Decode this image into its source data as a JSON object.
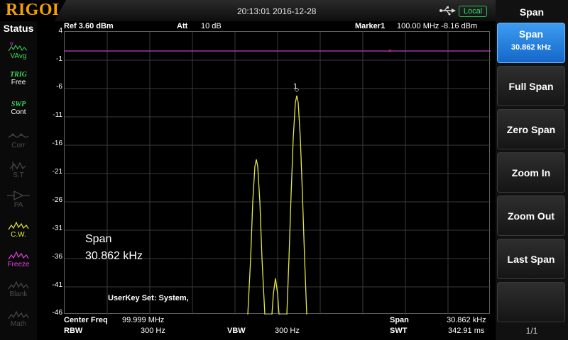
{
  "header": {
    "brand": "RIGOL",
    "datetime": "20:13:01 2016-12-28",
    "usb_icon": "usb-icon",
    "local_label": "Local"
  },
  "status_panel": {
    "title": "Status",
    "items": [
      {
        "top": "",
        "label": "VAvg",
        "icon": "avg-trace-icon",
        "color": "#3ddc5a",
        "dim": false
      },
      {
        "top": "TRIG",
        "label": "Free",
        "icon": "",
        "color": "#3ddc5a",
        "dim": false
      },
      {
        "top": "SWP",
        "label": "Cont",
        "icon": "",
        "color": "#3ddc5a",
        "dim": false
      },
      {
        "top": "",
        "label": "Corr",
        "icon": "correction-icon",
        "color": "#4a4a4a",
        "dim": true
      },
      {
        "top": "",
        "label": "S.T",
        "icon": "source-tracking-icon",
        "color": "#4a4a4a",
        "dim": true
      },
      {
        "top": "",
        "label": "PA",
        "icon": "preamp-icon",
        "color": "#4a4a4a",
        "dim": true
      },
      {
        "top": "",
        "label": "C.W.",
        "icon": "clear-write-icon",
        "color": "#e8e83a",
        "dim": false
      },
      {
        "top": "",
        "label": "Freeze",
        "icon": "freeze-icon",
        "color": "#e040e0",
        "dim": false
      },
      {
        "top": "",
        "label": "Blank",
        "icon": "blank-icon",
        "color": "#4a4a4a",
        "dim": true
      },
      {
        "top": "",
        "label": "Math",
        "icon": "math-icon",
        "color": "#4a4a4a",
        "dim": true
      }
    ]
  },
  "info_bar": {
    "ref": "Ref  3.60 dBm",
    "att": "Att",
    "att_value": "10 dB",
    "marker": "Marker1",
    "marker_value": "100.00 MHz  -8.16 dBm"
  },
  "y_ticks": [
    "4",
    "-1",
    "-6",
    "-11",
    "-16",
    "-21",
    "-26",
    "-31",
    "-36",
    "-41",
    "-46"
  ],
  "plot": {
    "marker_number": "1",
    "ref_line_color": "#c040c0",
    "trace_color": "#e8e840"
  },
  "annotation": {
    "line1": "Span",
    "line2": "30.862 kHz",
    "userkey": "UserKey Set:    System,"
  },
  "bottom": {
    "center_label": "Center Freq",
    "center_value": "99.999 MHz",
    "rbw_label": "RBW",
    "rbw_value": "300 Hz",
    "vbw_label": "VBW",
    "vbw_value": "300 Hz",
    "span_label": "Span",
    "span_value": "30.862 kHz",
    "swt_label": "SWT",
    "swt_value": "342.91 ms"
  },
  "menu": {
    "title": "Span",
    "span_label": "Span",
    "span_value": "30.862 kHz",
    "full_span": "Full Span",
    "zero_span": "Zero Span",
    "zoom_in": "Zoom In",
    "zoom_out": "Zoom Out",
    "last_span": "Last Span",
    "page": "1/1"
  }
}
